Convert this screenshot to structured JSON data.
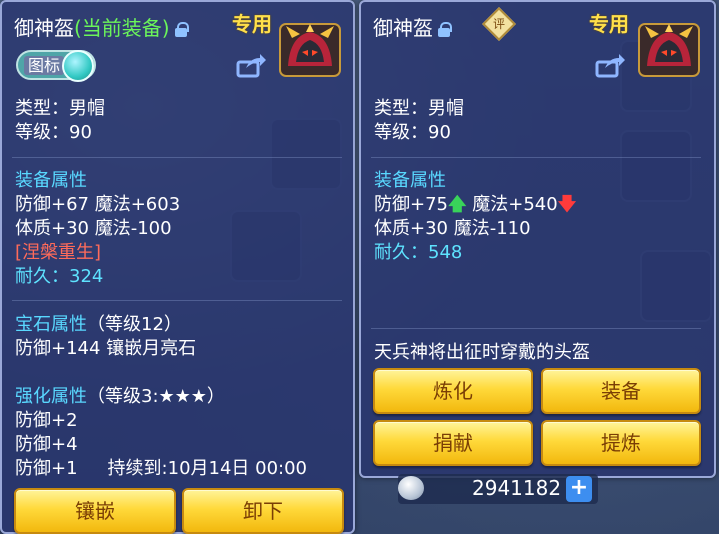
{
  "left_panel": {
    "title": "御神盔",
    "equipped_tag": "(当前装备)",
    "exclusive": "专用",
    "toggle_label": "图标",
    "type_line": "类型：男帽",
    "level_line": "等级：90",
    "equip_attr_header": "装备属性",
    "attr_line1": "防御+67 魔法+603",
    "attr_line2": "体质+30 魔法-100",
    "special": "[涅槃重生]",
    "durability_label": "耐久：",
    "durability_value": "324",
    "gem_header": "宝石属性",
    "gem_level": "（等级12）",
    "gem_line": "防御+144 镶嵌月亮石",
    "enhance_header": "强化属性",
    "enhance_level": "（等级3:★★★）",
    "enhance_line1": "防御+2",
    "enhance_line2": "防御+4",
    "enhance_line3": "防御+1",
    "enhance_duration": "持续到:10月14日 00:00",
    "btn_inlay": "镶嵌",
    "btn_unequip": "卸下"
  },
  "right_panel": {
    "title": "御神盔",
    "review_badge": "评",
    "exclusive": "专用",
    "type_line": "类型：男帽",
    "level_line": "等级：90",
    "equip_attr_header": "装备属性",
    "attr1_a": "防御+75",
    "attr1_b": "魔法+540",
    "attr2": "体质+30 魔法-110",
    "durability_label": "耐久：",
    "durability_value": "548",
    "description": "天兵神将出征时穿戴的头盔",
    "btn_refine": "炼化",
    "btn_equip": "装备",
    "btn_donate": "捐献",
    "btn_extract": "提炼"
  },
  "currency": {
    "value": "2941182",
    "plus": "+"
  },
  "arrows": {
    "up": "🡅",
    "down": "🡇"
  },
  "icons": [
    "lock-icon",
    "helmet-icon",
    "share-icon",
    "coin-icon",
    "plus-icon",
    "arrow-up-icon",
    "arrow-down-icon"
  ],
  "colors": {
    "panel_bg": "#28346e",
    "header_blue": "#59d8ff",
    "equipped_green": "#6bf55a",
    "special_red": "#ff6b5a",
    "exclusive_gold": "#ffe04a",
    "button_gold": "#ffd93a"
  }
}
